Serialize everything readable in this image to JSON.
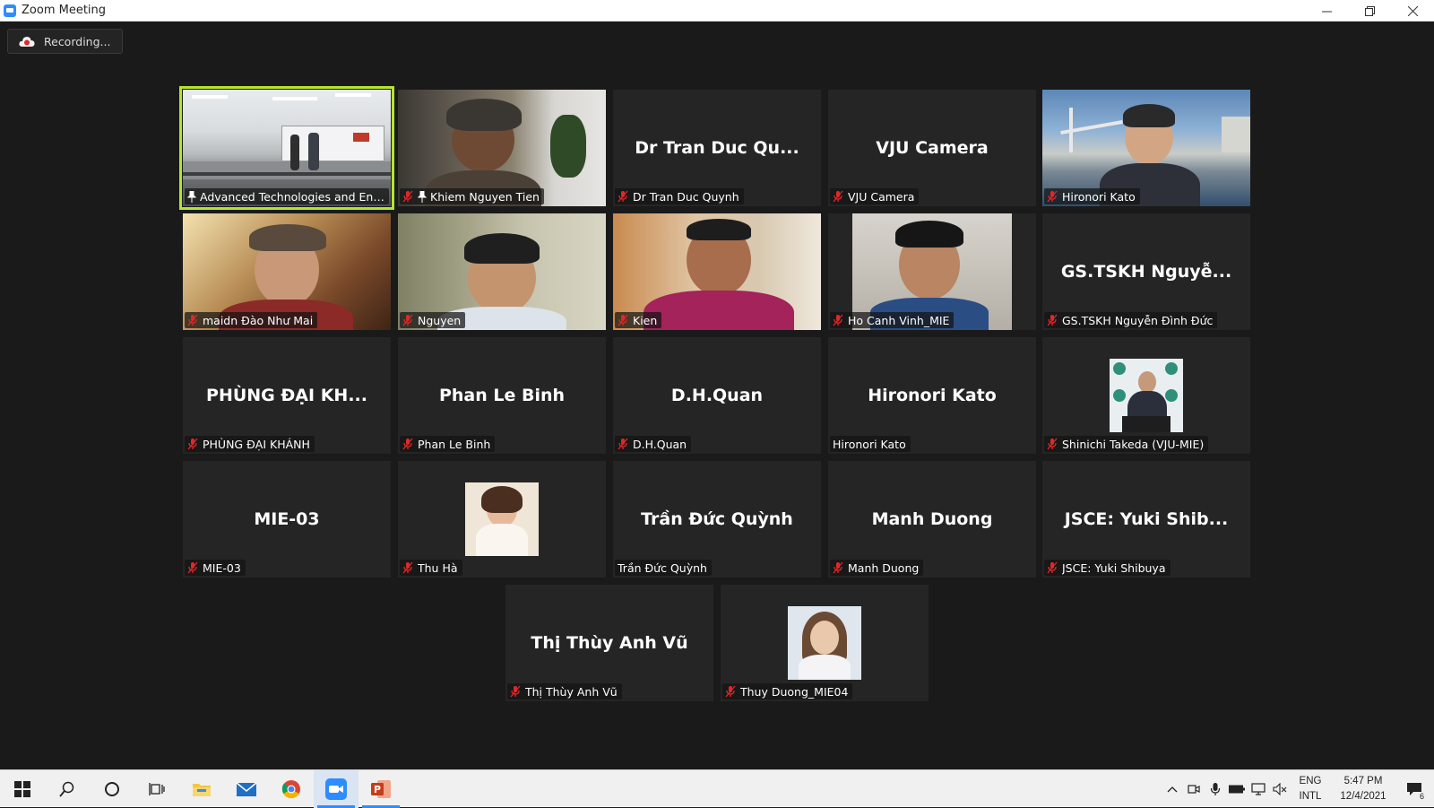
{
  "window": {
    "title": "Zoom Meeting"
  },
  "recording": {
    "label": "Recording..."
  },
  "tiles": [
    {
      "big": "",
      "caption": "Advanced Technologies and Engin...",
      "muted": false,
      "pinned": true,
      "active": true
    },
    {
      "big": "",
      "caption": "Khiem Nguyen Tien",
      "muted": true,
      "pinned": true
    },
    {
      "big": "Dr Tran Duc Qu...",
      "caption": "Dr Tran Duc Quynh",
      "muted": true
    },
    {
      "big": "VJU Camera",
      "caption": "VJU Camera",
      "muted": true
    },
    {
      "big": "",
      "caption": "Hironori Kato",
      "muted": true
    },
    {
      "big": "",
      "caption": "maidn Đào Như Mai",
      "muted": true
    },
    {
      "big": "",
      "caption": "Nguyen",
      "muted": true
    },
    {
      "big": "",
      "caption": "Kien",
      "muted": true
    },
    {
      "big": "",
      "caption": "Ho Canh Vinh_MIE",
      "muted": true
    },
    {
      "big": "GS.TSKH Nguyễ...",
      "caption": "GS.TSKH Nguyễn Đình Đức",
      "muted": true
    },
    {
      "big": "PHÙNG ĐẠI KH...",
      "caption": "PHÙNG ĐẠI KHÁNH",
      "muted": true
    },
    {
      "big": "Phan Le Binh",
      "caption": "Phan Le Binh",
      "muted": true
    },
    {
      "big": "D.H.Quan",
      "caption": "D.H.Quan",
      "muted": true
    },
    {
      "big": "Hironori Kato",
      "caption": "Hironori Kato",
      "muted": false
    },
    {
      "big": "",
      "caption": "Shinichi Takeda (VJU-MIE)",
      "muted": true
    },
    {
      "big": "MIE-03",
      "caption": "MIE-03",
      "muted": true
    },
    {
      "big": "",
      "caption": "Thu Hà",
      "muted": true
    },
    {
      "big": "Trần Đức Quỳnh",
      "caption": "Trần Đức Quỳnh",
      "muted": false
    },
    {
      "big": "Manh Duong",
      "caption": "Manh Duong",
      "muted": true
    },
    {
      "big": "JSCE: Yuki Shib...",
      "caption": "JSCE: Yuki Shibuya",
      "muted": true
    },
    {
      "big": "Thị Thùy Anh Vũ",
      "caption": "Thị Thùy Anh Vũ",
      "muted": true
    },
    {
      "big": "",
      "caption": "Thuy Duong_MIE04",
      "muted": true
    }
  ],
  "taskbar": {
    "apps": [
      "windows-start-icon",
      "search-icon",
      "cortana-icon",
      "task-view-icon",
      "file-explorer-icon",
      "mail-icon",
      "chrome-icon",
      "zoom-icon",
      "powerpoint-icon"
    ],
    "lang_line1": "ENG",
    "lang_line2": "INTL",
    "time": "5:47 PM",
    "date": "12/4/2021",
    "notification_count": "6"
  },
  "colors": {
    "active_speaker": "#b4e52a",
    "mute": "#e02828",
    "zoom_blue": "#2d8cff"
  }
}
